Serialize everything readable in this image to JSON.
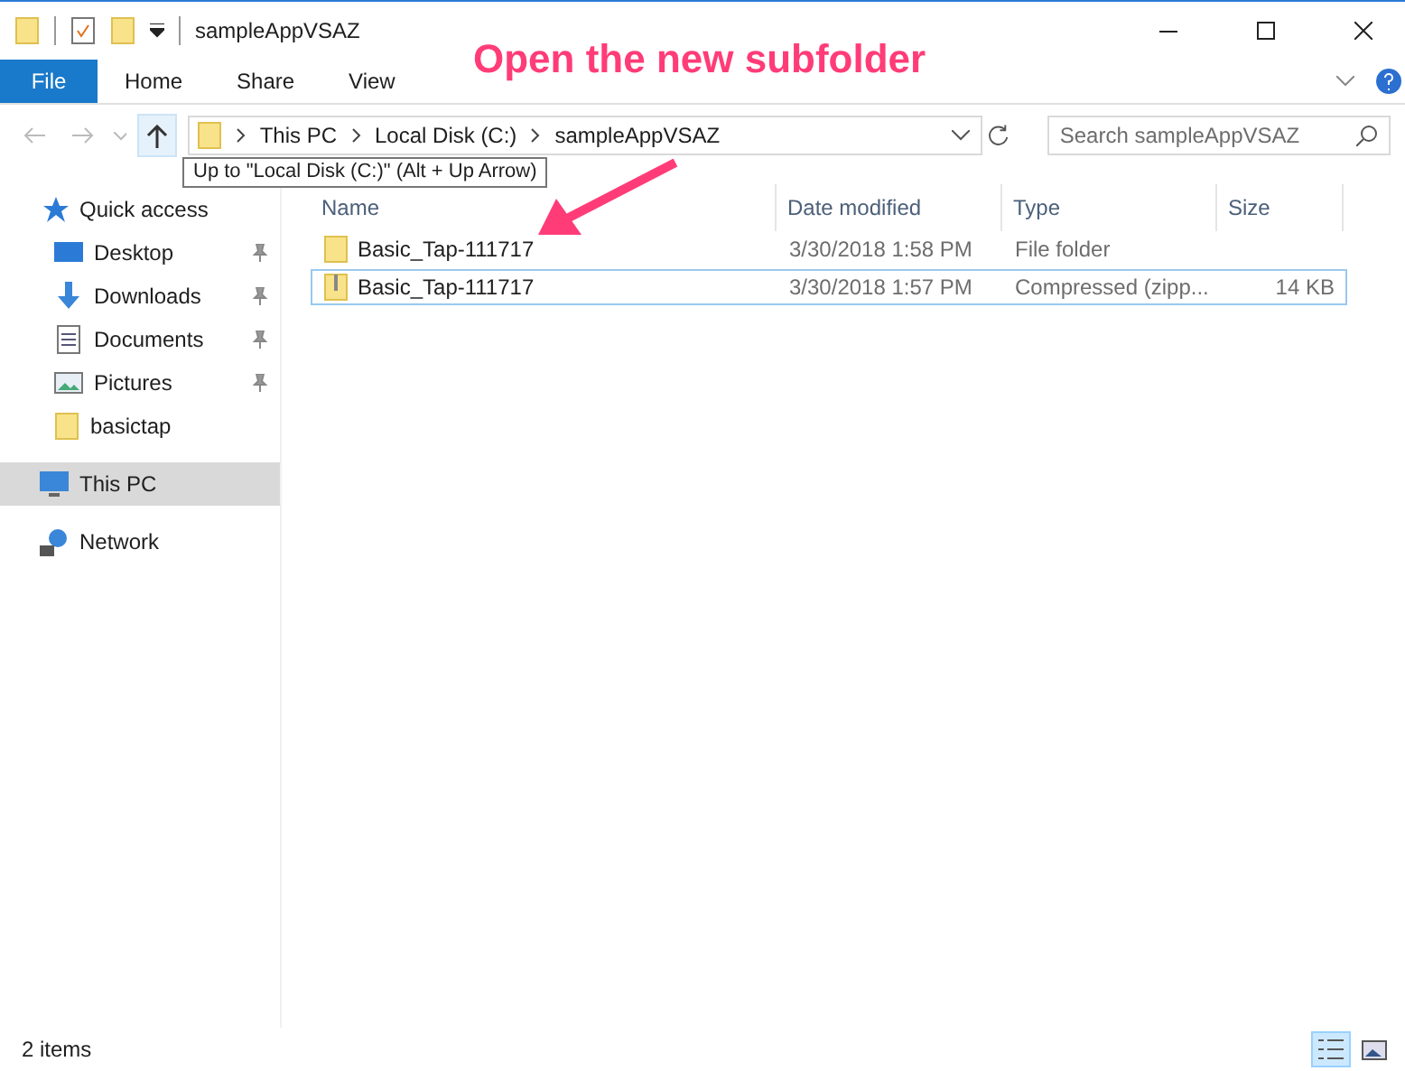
{
  "window": {
    "title": "sampleAppVSAZ"
  },
  "ribbon": {
    "file_tab": "File",
    "tabs": [
      "Home",
      "Share",
      "View"
    ]
  },
  "address": {
    "crumbs": [
      "This PC",
      "Local Disk (C:)",
      "sampleAppVSAZ"
    ]
  },
  "search": {
    "placeholder": "Search sampleAppVSAZ"
  },
  "tooltip": "Up to \"Local Disk (C:)\" (Alt + Up Arrow)",
  "sidebar": {
    "items": [
      {
        "label": "Quick access",
        "selected": false,
        "children": [
          {
            "label": "Desktop",
            "pinned": true,
            "selected": false
          },
          {
            "label": "Downloads",
            "pinned": true,
            "selected": false
          },
          {
            "label": "Documents",
            "pinned": true,
            "selected": false
          },
          {
            "label": "Pictures",
            "pinned": true,
            "selected": false
          },
          {
            "label": "basictap",
            "pinned": false,
            "selected": false
          }
        ]
      },
      {
        "label": "This PC",
        "selected": true
      },
      {
        "label": "Network",
        "selected": false
      }
    ]
  },
  "table": {
    "columns": [
      "Name",
      "Date modified",
      "Type",
      "Size"
    ],
    "rows": [
      {
        "name": "Basic_Tap-111717",
        "kind": "folder",
        "date": "3/30/2018 1:58 PM",
        "type": "File folder",
        "selected": false
      },
      {
        "name": "Basic_Tap-111717",
        "kind": "zip",
        "date": "3/30/2018 1:57 PM",
        "type": "Compressed (zipp...",
        "size": "14 KB",
        "selected": true
      }
    ]
  },
  "annotation": "Open the new subfolder",
  "status_bar": {
    "count": "2 items",
    "views": [
      {
        "kind": "details",
        "selected": true
      },
      {
        "kind": "thumbnails",
        "selected": false
      }
    ]
  }
}
